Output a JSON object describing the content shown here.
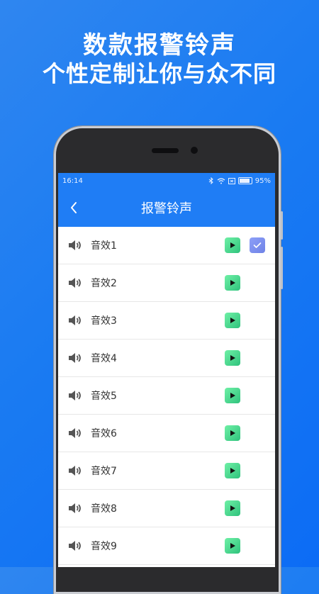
{
  "promo": {
    "line1": "数款报警铃声",
    "line2": "个性定制让你与众不同"
  },
  "status": {
    "time": "16:14",
    "battery": "95%"
  },
  "appbar": {
    "title": "报警铃声",
    "back_icon": "chevron-left-icon"
  },
  "sounds": [
    {
      "label": "音效1",
      "selected": true
    },
    {
      "label": "音效2",
      "selected": false
    },
    {
      "label": "音效3",
      "selected": false
    },
    {
      "label": "音效4",
      "selected": false
    },
    {
      "label": "音效5",
      "selected": false
    },
    {
      "label": "音效6",
      "selected": false
    },
    {
      "label": "音效7",
      "selected": false
    },
    {
      "label": "音效8",
      "selected": false
    },
    {
      "label": "音效9",
      "selected": false
    }
  ],
  "colors": {
    "primary": "#1f7df5",
    "play": "#3fd08a",
    "check": "#7b8ef0"
  }
}
